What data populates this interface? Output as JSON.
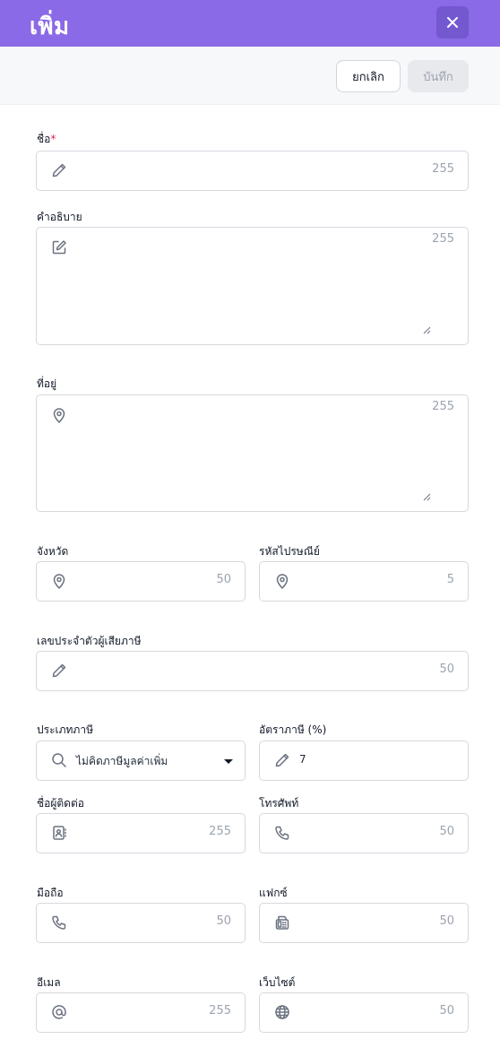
{
  "header": {
    "title": "เพิ่ม"
  },
  "toolbar": {
    "cancel_label": "ยกเลิก",
    "save_label": "บันทึก"
  },
  "fields": {
    "name": {
      "label": "ชื่อ",
      "required_mark": "*",
      "counter": "255"
    },
    "description": {
      "label": "คำอธิบาย",
      "counter": "255"
    },
    "address": {
      "label": "ที่อยู่",
      "counter": "255"
    },
    "province": {
      "label": "จังหวัด",
      "counter": "50"
    },
    "postal_code": {
      "label": "รหัสไปรษณีย์",
      "counter": "5"
    },
    "tax_id": {
      "label": "เลขประจำตัวผู้เสียภาษี",
      "counter": "50"
    },
    "tax_type": {
      "label": "ประเภทภาษี",
      "value": "ไม่คิดภาษีมูลค่าเพิ่ม"
    },
    "tax_rate": {
      "label": "อัตราภาษี (%)",
      "value": "7"
    },
    "contact_name": {
      "label": "ชื่อผู้ติดต่อ",
      "counter": "255"
    },
    "phone": {
      "label": "โทรศัพท์",
      "counter": "50"
    },
    "mobile": {
      "label": "มือถือ",
      "counter": "50"
    },
    "fax": {
      "label": "แฟกซ์",
      "counter": "50"
    },
    "email": {
      "label": "อีเมล",
      "counter": "255"
    },
    "website": {
      "label": "เว็บไซต์",
      "counter": "50"
    }
  },
  "icons": {
    "close": "close-icon",
    "pencil": "pencil-icon",
    "edit": "edit-square-icon",
    "location": "map-pin-icon",
    "search": "search-icon",
    "contact": "contact-card-icon",
    "phone": "phone-icon",
    "fax": "fax-icon",
    "at": "at-sign-icon",
    "globe": "globe-icon"
  },
  "colors": {
    "header": "#8a6ae6",
    "close_button": "#7458cf",
    "required": "#e11d48"
  }
}
